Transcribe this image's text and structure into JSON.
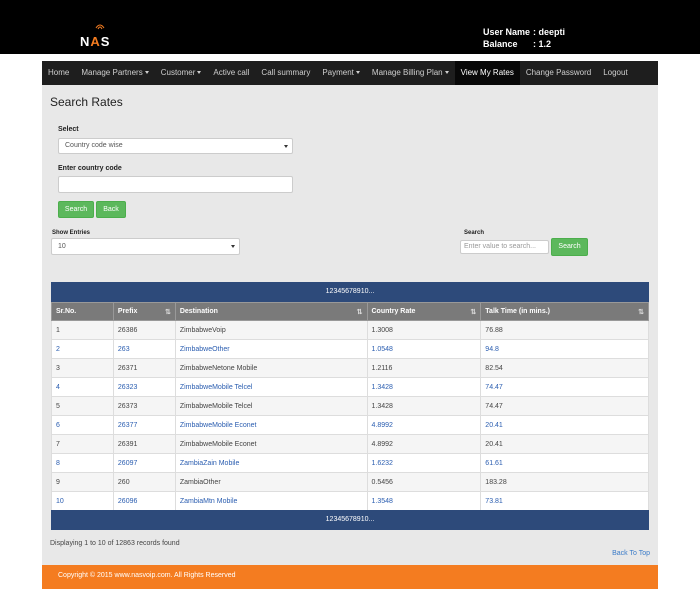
{
  "header": {
    "logo_text": "NAS",
    "user_name_label": "User Name",
    "user_name_value": ": deepti",
    "balance_label": "Balance",
    "balance_value": ": 1.2"
  },
  "nav": {
    "items": [
      {
        "label": "Home",
        "dropdown": false,
        "active": false
      },
      {
        "label": "Manage Partners",
        "dropdown": true,
        "active": false
      },
      {
        "label": "Customer",
        "dropdown": true,
        "active": false
      },
      {
        "label": "Active call",
        "dropdown": false,
        "active": false
      },
      {
        "label": "Call summary",
        "dropdown": false,
        "active": false
      },
      {
        "label": "Payment",
        "dropdown": true,
        "active": false
      },
      {
        "label": "Manage Billing Plan",
        "dropdown": true,
        "active": false
      },
      {
        "label": "View My Rates",
        "dropdown": false,
        "active": true
      },
      {
        "label": "Change Password",
        "dropdown": false,
        "active": false
      },
      {
        "label": "Logout",
        "dropdown": false,
        "active": false
      }
    ]
  },
  "main": {
    "title": "Search Rates",
    "select_label": "Select",
    "select_value": "Country code wise",
    "country_code_label": "Enter country code",
    "country_code_value": "",
    "search_button": "Search",
    "back_button": "Back",
    "show_entries_label": "Show Entries",
    "show_entries_value": "10",
    "table_search_label": "Search",
    "table_search_placeholder": "Enter value to search...",
    "table_search_button": "Search",
    "pagination_top": "12345678910...",
    "pagination_bottom": "12345678910...",
    "records_info": "Displaying 1 to 10 of 12863 records found",
    "back_to_top": "Back To Top"
  },
  "table": {
    "columns": [
      "Sr.No.",
      "Prefix",
      "Destination",
      "Country Rate",
      "Talk Time (in mins.)"
    ],
    "rows": [
      [
        "1",
        "26386",
        "ZimbabweVoip",
        "1.3008",
        "76.88"
      ],
      [
        "2",
        "263",
        "ZimbabweOther",
        "1.0548",
        "94.8"
      ],
      [
        "3",
        "26371",
        "ZimbabweNetone Mobile",
        "1.2116",
        "82.54"
      ],
      [
        "4",
        "26323",
        "ZimbabweMobile Telcel",
        "1.3428",
        "74.47"
      ],
      [
        "5",
        "26373",
        "ZimbabweMobile Telcel",
        "1.3428",
        "74.47"
      ],
      [
        "6",
        "26377",
        "ZimbabweMobile Econet",
        "4.8992",
        "20.41"
      ],
      [
        "7",
        "26391",
        "ZimbabweMobile Econet",
        "4.8992",
        "20.41"
      ],
      [
        "8",
        "26097",
        "ZambiaZain Mobile",
        "1.6232",
        "61.61"
      ],
      [
        "9",
        "260",
        "ZambiaOther",
        "0.5456",
        "183.28"
      ],
      [
        "10",
        "26096",
        "ZambiaMtn Mobile",
        "1.3548",
        "73.81"
      ]
    ]
  },
  "footer": {
    "copyright": "Copyright © 2015 www.nasvoip.com. All Rights Reserved"
  },
  "colors": {
    "brand_orange": "#f47c20",
    "table_header_blue": "#2d4a7a",
    "button_green": "#5cb85c"
  }
}
